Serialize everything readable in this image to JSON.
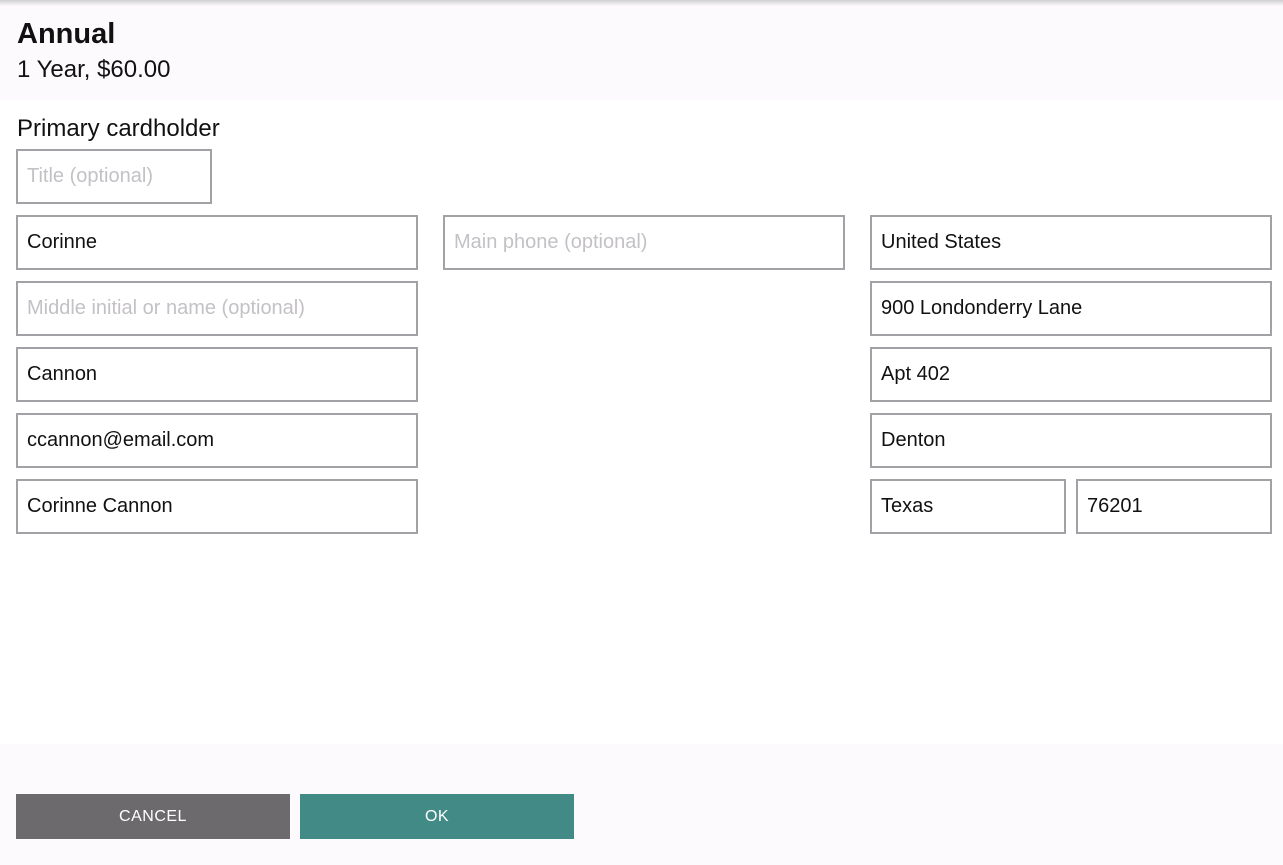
{
  "header": {
    "plan_name": "Annual",
    "plan_price": "1 Year, $60.00"
  },
  "form": {
    "section_title": "Primary cardholder",
    "title": {
      "value": "",
      "placeholder": "Title (optional)"
    },
    "first_name": {
      "value": "Corinne",
      "placeholder": ""
    },
    "middle_name": {
      "value": "",
      "placeholder": "Middle initial or name (optional)"
    },
    "last_name": {
      "value": "Cannon",
      "placeholder": ""
    },
    "email": {
      "value": "ccannon@email.com",
      "placeholder": ""
    },
    "card_name": {
      "value": "Corinne Cannon",
      "placeholder": ""
    },
    "main_phone": {
      "value": "",
      "placeholder": "Main phone (optional)"
    },
    "country": {
      "value": "United States",
      "placeholder": ""
    },
    "address_line1": {
      "value": "900 Londonderry Lane",
      "placeholder": ""
    },
    "address_line2": {
      "value": "Apt 402",
      "placeholder": ""
    },
    "city": {
      "value": "Denton",
      "placeholder": ""
    },
    "state": {
      "value": "Texas",
      "placeholder": ""
    },
    "zip": {
      "value": "76201",
      "placeholder": ""
    }
  },
  "buttons": {
    "cancel_label": "CANCEL",
    "ok_label": "OK"
  },
  "colors": {
    "ok_button": "#418a85",
    "cancel_button": "#6d6a6e",
    "field_border": "#a3a1a5"
  }
}
